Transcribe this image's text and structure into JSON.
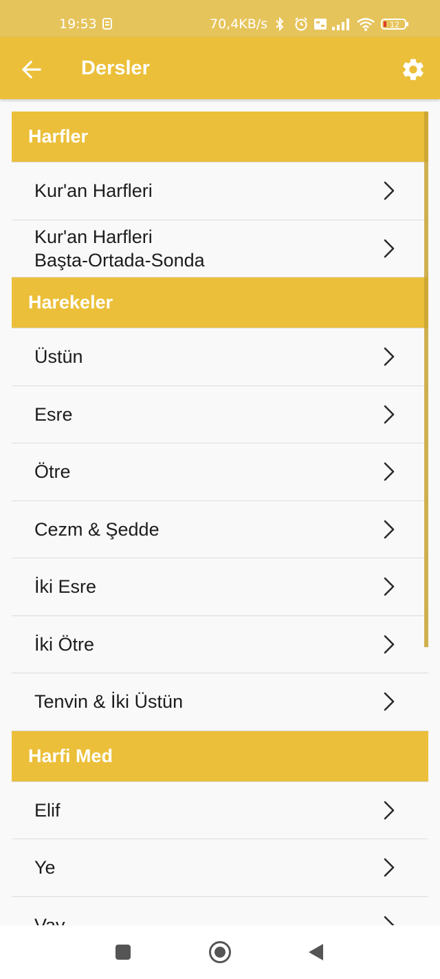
{
  "status_bar": {
    "time": "19:53",
    "network_speed": "70,4KB/s",
    "battery_level": "12",
    "icons": [
      "notification-icon",
      "bluetooth-icon",
      "alarm-icon",
      "volte-icon",
      "signal-icon",
      "wifi-icon",
      "battery-icon"
    ]
  },
  "app_bar": {
    "title": "Dersler",
    "back_icon": "arrow-left-icon",
    "settings_icon": "gear-icon"
  },
  "sections": [
    {
      "title": "Harfler",
      "items": [
        "Kur'an Harfleri",
        "Kur'an Harfleri\nBaşta-Ortada-Sonda"
      ]
    },
    {
      "title": "Harekeler",
      "items": [
        "Üstün",
        "Esre",
        "Ötre",
        "Cezm & Şedde",
        "İki Esre",
        "İki Ötre",
        "Tenvin & İki Üstün"
      ]
    },
    {
      "title": "Harfi Med",
      "items": [
        "Elif",
        "Ye",
        "Vav"
      ]
    }
  ],
  "colors": {
    "accent": "#ebbf39",
    "status_bar": "#e6c45c",
    "background": "#f9f9f9"
  },
  "nav_bar": {
    "icons": [
      "recents-square-icon",
      "home-circle-icon",
      "back-triangle-icon"
    ]
  }
}
